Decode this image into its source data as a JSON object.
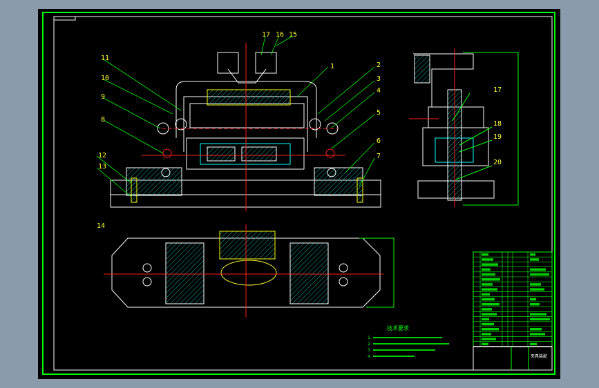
{
  "drawing": {
    "part_numbers_front": [
      "1",
      "2",
      "3",
      "4",
      "5",
      "6",
      "7",
      "8",
      "9",
      "10",
      "11",
      "12",
      "13",
      "15",
      "16",
      "17"
    ],
    "part_numbers_side": [
      "17",
      "18",
      "19",
      "20"
    ],
    "part_number_top": "14",
    "tech_requirements_title": "技术要求",
    "tech_requirements": [
      "1.",
      "2.",
      "3.",
      "4."
    ],
    "title_block_name": "夹具装配"
  },
  "colors": {
    "background": "#8c9bab",
    "sheet": "#000000",
    "border": "#00ff00",
    "outline": "#ffffff",
    "centerline": "#ff2020",
    "labels": "#ffff33",
    "hatch": "#00c0c0"
  }
}
